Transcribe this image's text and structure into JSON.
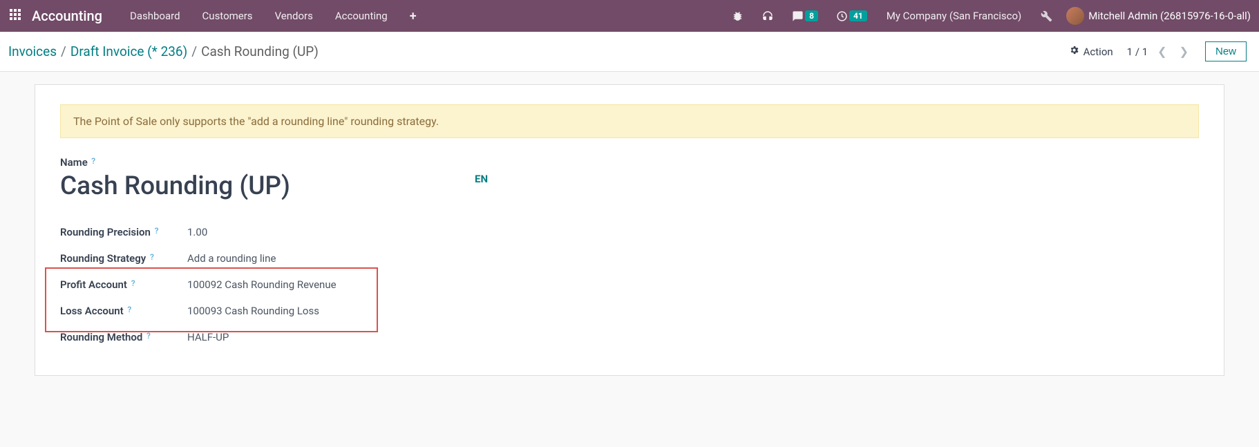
{
  "topbar": {
    "brand": "Accounting",
    "nav": [
      "Dashboard",
      "Customers",
      "Vendors",
      "Accounting"
    ],
    "messages_badge": "8",
    "activities_badge": "41",
    "company": "My Company (San Francisco)",
    "user": "Mitchell Admin (26815976-16-0-all)"
  },
  "breadcrumb": {
    "items": [
      "Invoices",
      "Draft Invoice (* 236)"
    ],
    "current": "Cash Rounding (UP)"
  },
  "header": {
    "action_label": "Action",
    "pager": "1 / 1",
    "new_label": "New"
  },
  "alert": "The Point of Sale only supports the \"add a rounding line\" rounding strategy.",
  "form": {
    "name_label": "Name",
    "name_value": "Cash Rounding (UP)",
    "lang": "EN",
    "rows": [
      {
        "label": "Rounding Precision",
        "value": "1.00"
      },
      {
        "label": "Rounding Strategy",
        "value": "Add a rounding line"
      },
      {
        "label": "Profit Account",
        "value": "100092 Cash Rounding Revenue"
      },
      {
        "label": "Loss Account",
        "value": "100093 Cash Rounding Loss"
      },
      {
        "label": "Rounding Method",
        "value": "HALF-UP"
      }
    ]
  }
}
